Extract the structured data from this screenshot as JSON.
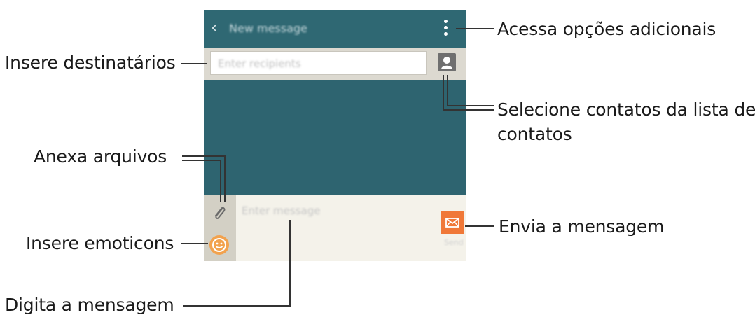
{
  "app": {
    "title": "New message",
    "recipient_placeholder": "Enter recipients",
    "message_placeholder": "Enter message",
    "send_label": "Send"
  },
  "callouts": {
    "more_options": "Acessa opções adicionais",
    "recipients": "Insere destinatários",
    "contacts_line1": "Selecione contatos da lista de",
    "contacts_line2": "contatos",
    "attach": "Anexa arquivos",
    "emoticons": "Insere emoticons",
    "send": "Envia a mensagem",
    "type": "Digita a mensagem"
  },
  "colors": {
    "appbar": "#2f6873",
    "panel": "#2e6470",
    "send": "#f07838",
    "emoticon": "#f2a24e"
  },
  "icons": [
    "back-icon",
    "more-options-icon",
    "contact-icon",
    "paperclip-icon",
    "smiley-icon",
    "envelope-icon"
  ]
}
